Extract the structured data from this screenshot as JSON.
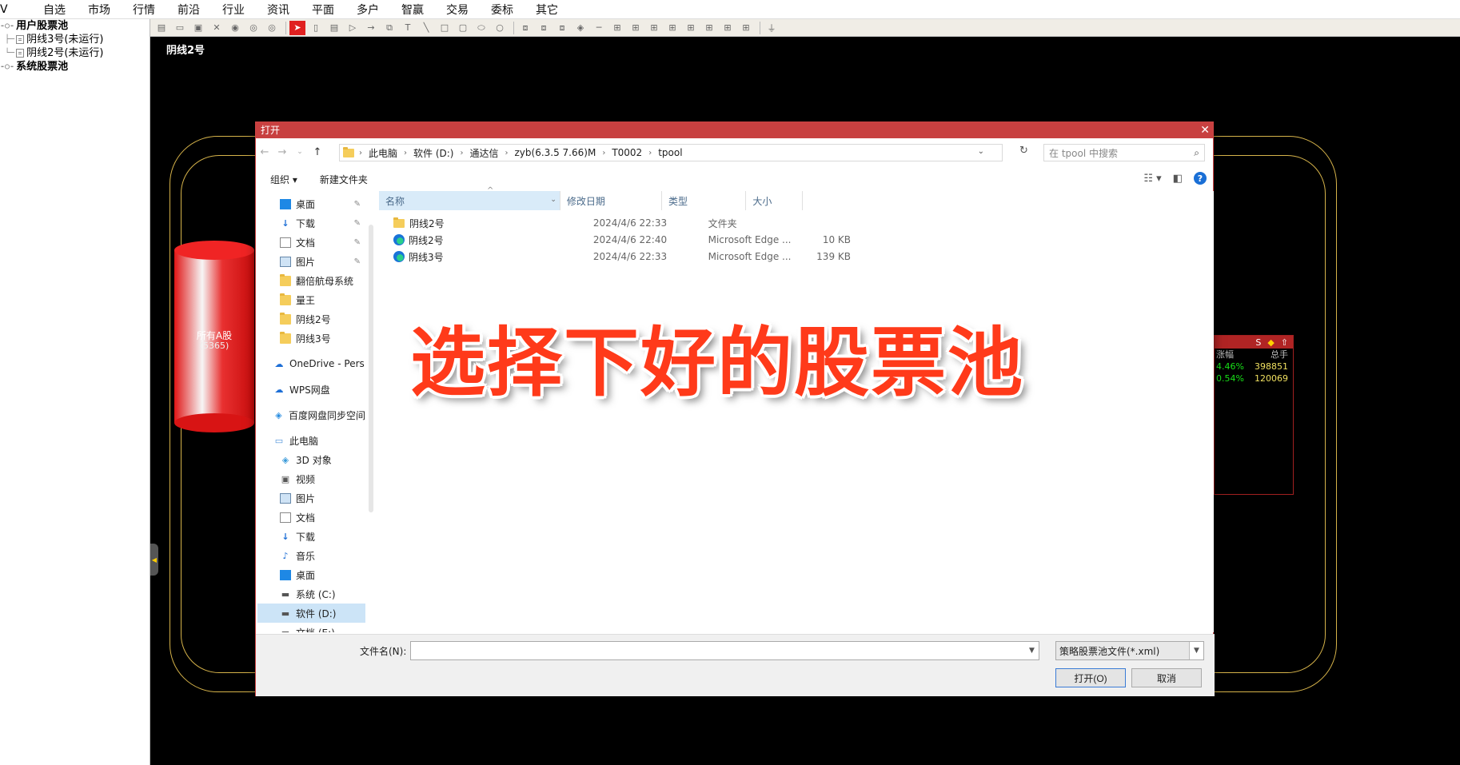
{
  "menubar": {
    "logo": "V",
    "items": [
      "自选",
      "市场",
      "行情",
      "前沿",
      "行业",
      "资讯",
      "平面",
      "多户",
      "智赢",
      "交易",
      "委标",
      "其它"
    ]
  },
  "left_tree": {
    "user_pools": "用户股票池",
    "items": [
      "阴线3号(未运行)",
      "阴线2号(未运行)"
    ],
    "system_pools": "系统股票池"
  },
  "main": {
    "title": "阴线2号",
    "cylinder_label": "所有A股",
    "cylinder_count": "(5365)"
  },
  "right_panel": {
    "header_icons": [
      "S",
      "◆",
      "⇧"
    ],
    "col_change": "涨幅",
    "col_volume": "总手",
    "rows": [
      {
        "change": "4.46%",
        "volume": "398851"
      },
      {
        "change": "0.54%",
        "volume": "120069"
      }
    ]
  },
  "dialog": {
    "title": "打开",
    "breadcrumbs": [
      "此电脑",
      "软件 (D:)",
      "通达信",
      "zyb(6.3.5 7.66)M",
      "T0002",
      "tpool"
    ],
    "search_placeholder": "在 tpool 中搜索",
    "organize_label": "组织 ▾",
    "new_folder_label": "新建文件夹",
    "nav_items": [
      {
        "label": "桌面",
        "icon": "desktop-icon",
        "pinned": true
      },
      {
        "label": "下载",
        "icon": "download-icon",
        "pinned": true
      },
      {
        "label": "文档",
        "icon": "document-icon",
        "pinned": true
      },
      {
        "label": "图片",
        "icon": "picture-icon",
        "pinned": true
      },
      {
        "label": "翻倍航母系统",
        "icon": "folder-icon",
        "pinned": false
      },
      {
        "label": "量王",
        "icon": "folder-icon",
        "pinned": false
      },
      {
        "label": "阴线2号",
        "icon": "folder-icon",
        "pinned": false
      },
      {
        "label": "阴线3号",
        "icon": "folder-icon",
        "pinned": false
      },
      {
        "label": "OneDrive - Pers",
        "icon": "cloud-icon",
        "pinned": false
      },
      {
        "label": "WPS网盘",
        "icon": "wps-cloud-icon",
        "pinned": false
      },
      {
        "label": "百度网盘同步空间",
        "icon": "baidu-icon",
        "pinned": false
      },
      {
        "label": "此电脑",
        "icon": "computer-icon",
        "pinned": false
      },
      {
        "label": "3D 对象",
        "icon": "cube-icon",
        "pinned": false
      },
      {
        "label": "视频",
        "icon": "video-icon",
        "pinned": false
      },
      {
        "label": "图片",
        "icon": "picture-icon",
        "pinned": false
      },
      {
        "label": "文档",
        "icon": "document-icon",
        "pinned": false
      },
      {
        "label": "下载",
        "icon": "download-icon",
        "pinned": false
      },
      {
        "label": "音乐",
        "icon": "music-icon",
        "pinned": false
      },
      {
        "label": "桌面",
        "icon": "desktop-icon",
        "pinned": false
      },
      {
        "label": "系统 (C:)",
        "icon": "drive-icon",
        "pinned": false
      },
      {
        "label": "软件 (D:)",
        "icon": "drive-icon",
        "pinned": false,
        "selected": true
      },
      {
        "label": "文档 (E:)",
        "icon": "drive-icon",
        "pinned": false
      }
    ],
    "columns": {
      "name": "名称",
      "date": "修改日期",
      "type": "类型",
      "size": "大小"
    },
    "files": [
      {
        "name": "阴线2号",
        "date": "2024/4/6 22:33",
        "type": "文件夹",
        "size": "",
        "icon": "folder-icon"
      },
      {
        "name": "阴线2号",
        "date": "2024/4/6 22:40",
        "type": "Microsoft Edge ...",
        "size": "10 KB",
        "icon": "edge-icon"
      },
      {
        "name": "阴线3号",
        "date": "2024/4/6 22:33",
        "type": "Microsoft Edge ...",
        "size": "139 KB",
        "icon": "edge-icon"
      }
    ],
    "filename_label": "文件名(N):",
    "filename_value": "",
    "filter_value": "策略股票池文件(*.xml)",
    "open_label": "打开(O)",
    "cancel_label": "取消"
  },
  "overlay_caption": "选择下好的股票池"
}
